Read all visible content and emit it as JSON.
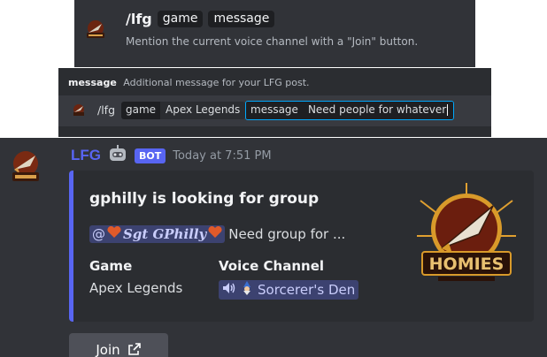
{
  "command_hint": {
    "command": "/lfg",
    "options": [
      "game",
      "message"
    ],
    "description": "Mention the current voice channel with a \"Join\" button.",
    "logo_text": "HOMIES"
  },
  "option_input": {
    "option_name": "message",
    "option_description": "Additional message for your LFG post.",
    "command": "/lfg",
    "game_key": "game",
    "game_value": "Apex Legends",
    "message_key": "message",
    "message_value": "Need people for whatever"
  },
  "message": {
    "username": "LFG",
    "badge": "BOT",
    "timestamp": "Today at 7:51 PM",
    "avatar_text": "HOMIES",
    "embed": {
      "accent_color": "#5865f2",
      "title": "gphilly is looking for group",
      "mention": "Sgt GPhilly",
      "mention_prefix": "@",
      "description": "Need group for ...",
      "fields": [
        {
          "name": "Game",
          "value": "Apex Legends"
        },
        {
          "name": "Voice Channel",
          "value": "Sorcerer's Den"
        }
      ],
      "thumbnail_text": "HOMIES"
    },
    "join_button": "Join"
  },
  "colors": {
    "background": "#313338",
    "embed_bg": "#2b2d31",
    "blurple": "#5865f2",
    "button": "#4e5058"
  }
}
